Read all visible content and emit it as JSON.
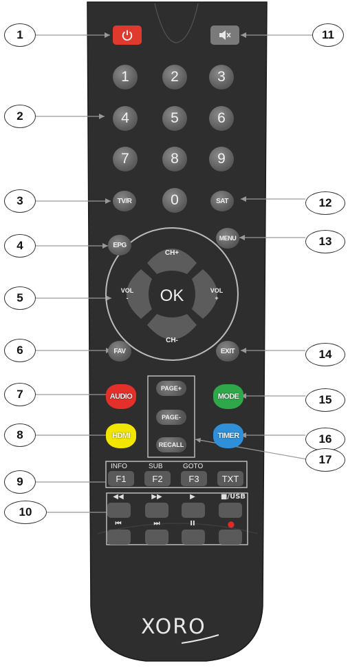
{
  "keypad": {
    "digits": [
      "1",
      "2",
      "3",
      "4",
      "5",
      "6",
      "7",
      "8",
      "9",
      "0"
    ],
    "tvr": "TV/R",
    "sat": "SAT"
  },
  "nav": {
    "epg": "EPG",
    "menu": "MENU",
    "ch_up": "CH+",
    "ch_down": "CH-",
    "vol_down": "VOL\n-",
    "vol_up": "VOL\n+",
    "ok": "OK",
    "fav": "FAV",
    "exit": "EXIT"
  },
  "color_keys": {
    "audio": "AUDIO",
    "hdmi": "HDMI",
    "mode": "MODE",
    "timer": "TIMER",
    "page_up": "PAGE+",
    "page_down": "PAGE-",
    "recall": "RECALL"
  },
  "function_keys": {
    "info_label": "INFO",
    "sub_label": "SUB",
    "goto_label": "GOTO",
    "f1": "F1",
    "f2": "F2",
    "f3": "F3",
    "txt": "TXT"
  },
  "media_keys": {
    "rewind": "◀◀",
    "fast_forward": "▶▶",
    "play": "▶",
    "stop_usb": "■/USB",
    "prev": "⏮",
    "next": "⏭",
    "pause": "II",
    "record": "●"
  },
  "brand": "XORO",
  "callouts": [
    "1",
    "2",
    "3",
    "4",
    "5",
    "6",
    "7",
    "8",
    "9",
    "10",
    "11",
    "12",
    "13",
    "14",
    "15",
    "16",
    "17"
  ],
  "colors": {
    "body": "#2e2e2e",
    "power": "#e03a2f",
    "audio": "#e3302a",
    "hdmi": "#f2e600",
    "mode": "#2fa84a",
    "timer": "#2f8fd8",
    "record": "#e02a2a"
  }
}
